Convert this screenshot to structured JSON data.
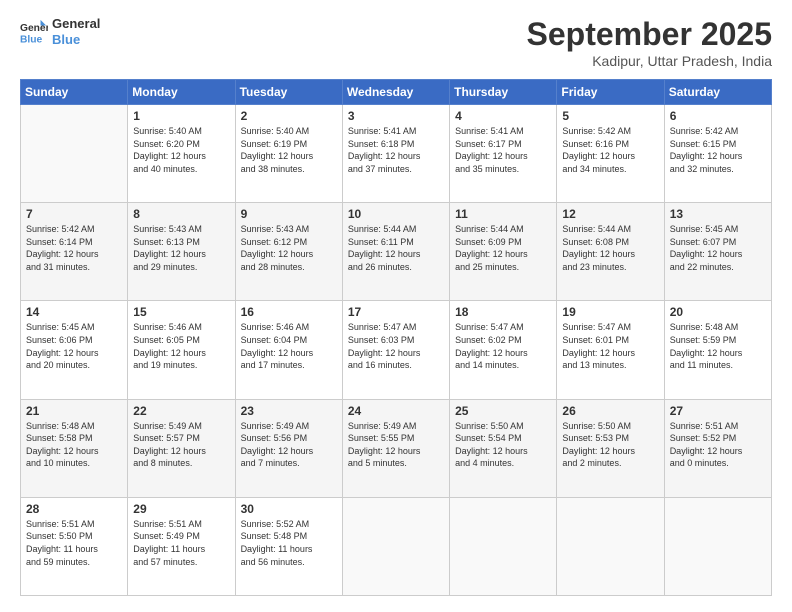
{
  "header": {
    "logo_line1": "General",
    "logo_line2": "Blue",
    "month_title": "September 2025",
    "subtitle": "Kadipur, Uttar Pradesh, India"
  },
  "weekdays": [
    "Sunday",
    "Monday",
    "Tuesday",
    "Wednesday",
    "Thursday",
    "Friday",
    "Saturday"
  ],
  "weeks": [
    [
      {
        "day": "",
        "info": ""
      },
      {
        "day": "1",
        "info": "Sunrise: 5:40 AM\nSunset: 6:20 PM\nDaylight: 12 hours\nand 40 minutes."
      },
      {
        "day": "2",
        "info": "Sunrise: 5:40 AM\nSunset: 6:19 PM\nDaylight: 12 hours\nand 38 minutes."
      },
      {
        "day": "3",
        "info": "Sunrise: 5:41 AM\nSunset: 6:18 PM\nDaylight: 12 hours\nand 37 minutes."
      },
      {
        "day": "4",
        "info": "Sunrise: 5:41 AM\nSunset: 6:17 PM\nDaylight: 12 hours\nand 35 minutes."
      },
      {
        "day": "5",
        "info": "Sunrise: 5:42 AM\nSunset: 6:16 PM\nDaylight: 12 hours\nand 34 minutes."
      },
      {
        "day": "6",
        "info": "Sunrise: 5:42 AM\nSunset: 6:15 PM\nDaylight: 12 hours\nand 32 minutes."
      }
    ],
    [
      {
        "day": "7",
        "info": "Sunrise: 5:42 AM\nSunset: 6:14 PM\nDaylight: 12 hours\nand 31 minutes."
      },
      {
        "day": "8",
        "info": "Sunrise: 5:43 AM\nSunset: 6:13 PM\nDaylight: 12 hours\nand 29 minutes."
      },
      {
        "day": "9",
        "info": "Sunrise: 5:43 AM\nSunset: 6:12 PM\nDaylight: 12 hours\nand 28 minutes."
      },
      {
        "day": "10",
        "info": "Sunrise: 5:44 AM\nSunset: 6:11 PM\nDaylight: 12 hours\nand 26 minutes."
      },
      {
        "day": "11",
        "info": "Sunrise: 5:44 AM\nSunset: 6:09 PM\nDaylight: 12 hours\nand 25 minutes."
      },
      {
        "day": "12",
        "info": "Sunrise: 5:44 AM\nSunset: 6:08 PM\nDaylight: 12 hours\nand 23 minutes."
      },
      {
        "day": "13",
        "info": "Sunrise: 5:45 AM\nSunset: 6:07 PM\nDaylight: 12 hours\nand 22 minutes."
      }
    ],
    [
      {
        "day": "14",
        "info": "Sunrise: 5:45 AM\nSunset: 6:06 PM\nDaylight: 12 hours\nand 20 minutes."
      },
      {
        "day": "15",
        "info": "Sunrise: 5:46 AM\nSunset: 6:05 PM\nDaylight: 12 hours\nand 19 minutes."
      },
      {
        "day": "16",
        "info": "Sunrise: 5:46 AM\nSunset: 6:04 PM\nDaylight: 12 hours\nand 17 minutes."
      },
      {
        "day": "17",
        "info": "Sunrise: 5:47 AM\nSunset: 6:03 PM\nDaylight: 12 hours\nand 16 minutes."
      },
      {
        "day": "18",
        "info": "Sunrise: 5:47 AM\nSunset: 6:02 PM\nDaylight: 12 hours\nand 14 minutes."
      },
      {
        "day": "19",
        "info": "Sunrise: 5:47 AM\nSunset: 6:01 PM\nDaylight: 12 hours\nand 13 minutes."
      },
      {
        "day": "20",
        "info": "Sunrise: 5:48 AM\nSunset: 5:59 PM\nDaylight: 12 hours\nand 11 minutes."
      }
    ],
    [
      {
        "day": "21",
        "info": "Sunrise: 5:48 AM\nSunset: 5:58 PM\nDaylight: 12 hours\nand 10 minutes."
      },
      {
        "day": "22",
        "info": "Sunrise: 5:49 AM\nSunset: 5:57 PM\nDaylight: 12 hours\nand 8 minutes."
      },
      {
        "day": "23",
        "info": "Sunrise: 5:49 AM\nSunset: 5:56 PM\nDaylight: 12 hours\nand 7 minutes."
      },
      {
        "day": "24",
        "info": "Sunrise: 5:49 AM\nSunset: 5:55 PM\nDaylight: 12 hours\nand 5 minutes."
      },
      {
        "day": "25",
        "info": "Sunrise: 5:50 AM\nSunset: 5:54 PM\nDaylight: 12 hours\nand 4 minutes."
      },
      {
        "day": "26",
        "info": "Sunrise: 5:50 AM\nSunset: 5:53 PM\nDaylight: 12 hours\nand 2 minutes."
      },
      {
        "day": "27",
        "info": "Sunrise: 5:51 AM\nSunset: 5:52 PM\nDaylight: 12 hours\nand 0 minutes."
      }
    ],
    [
      {
        "day": "28",
        "info": "Sunrise: 5:51 AM\nSunset: 5:50 PM\nDaylight: 11 hours\nand 59 minutes."
      },
      {
        "day": "29",
        "info": "Sunrise: 5:51 AM\nSunset: 5:49 PM\nDaylight: 11 hours\nand 57 minutes."
      },
      {
        "day": "30",
        "info": "Sunrise: 5:52 AM\nSunset: 5:48 PM\nDaylight: 11 hours\nand 56 minutes."
      },
      {
        "day": "",
        "info": ""
      },
      {
        "day": "",
        "info": ""
      },
      {
        "day": "",
        "info": ""
      },
      {
        "day": "",
        "info": ""
      }
    ]
  ]
}
